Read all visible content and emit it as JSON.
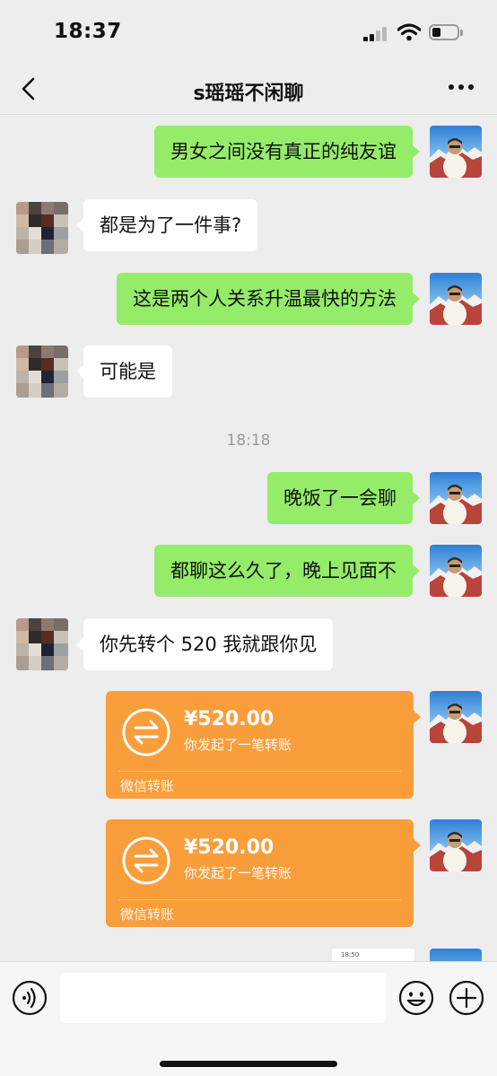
{
  "status_bar": {
    "time": "18:37",
    "battery_level": 0.35
  },
  "header": {
    "title": "s瑶瑶不闲聊",
    "back_icon": "chevron-left-icon",
    "more_icon": "ellipsis-icon"
  },
  "messages": [
    {
      "sender": "me",
      "text": "男女之间没有真正的纯友谊"
    },
    {
      "sender": "other",
      "text": "都是为了一件事?"
    },
    {
      "sender": "me",
      "text": "这是两个人关系升温最快的方法"
    },
    {
      "sender": "other",
      "text": "可能是"
    },
    {
      "type": "timestamp",
      "text": "18:18"
    },
    {
      "sender": "me",
      "text": "晚饭了一会聊"
    },
    {
      "sender": "me",
      "text": "都聊这么久了，晚上见面不"
    },
    {
      "sender": "other",
      "text": "你先转个 520  我就跟你见"
    }
  ],
  "transfers": [
    {
      "amount": "¥520.00",
      "description": "你发起了一笔转账",
      "footer": "微信转账"
    },
    {
      "amount": "¥520.00",
      "description": "你发起了一笔转账",
      "footer": "微信转账"
    }
  ],
  "partial_image": {
    "text": "18:50"
  },
  "input_bar": {
    "placeholder": "",
    "voice_icon": "voice-icon",
    "emoji_icon": "emoji-icon",
    "plus_icon": "plus-icon"
  },
  "colors": {
    "background": "#ededed",
    "my_bubble": "#95ec69",
    "other_bubble": "#ffffff",
    "transfer": "#fa9d3b",
    "timestamp": "#9b9b9b"
  }
}
